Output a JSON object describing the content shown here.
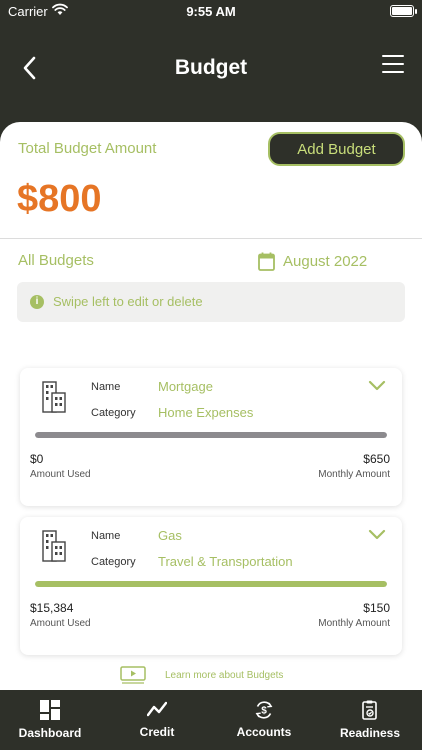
{
  "status_bar": {
    "carrier": "Carrier",
    "time": "9:55 AM"
  },
  "header": {
    "title": "Budget"
  },
  "summary": {
    "total_label": "Total Budget Amount",
    "total_amount": "$800",
    "add_button": "Add Budget"
  },
  "filter": {
    "all_label": "All Budgets",
    "month": "August 2022"
  },
  "hint": {
    "text": "Swipe left to edit or delete",
    "icon": "info-icon"
  },
  "budgets": [
    {
      "name_key": "Name",
      "name": "Mortgage",
      "category_key": "Category",
      "category": "Home Expenses",
      "used_value": "$0",
      "used_label": "Amount Used",
      "monthly_value": "$650",
      "monthly_label": "Monthly Amount",
      "progress": 1.0,
      "bar_color": "#8c8a8e"
    },
    {
      "name_key": "Name",
      "name": "Gas",
      "category_key": "Category",
      "category": "Travel & Transportation",
      "used_value": "$15,384",
      "used_label": "Amount Used",
      "monthly_value": "$150",
      "monthly_label": "Monthly Amount",
      "progress": 1.0,
      "bar_color": "#a6bf63"
    }
  ],
  "learn_more": {
    "text": "Learn more about Budgets",
    "icon": "video-play-icon"
  },
  "tabs": [
    {
      "label": "Dashboard",
      "icon": "dashboard-grid-icon"
    },
    {
      "label": "Credit",
      "icon": "trend-line-icon"
    },
    {
      "label": "Accounts",
      "icon": "dollar-cycle-icon"
    },
    {
      "label": "Readiness",
      "icon": "checklist-icon"
    }
  ],
  "colors": {
    "dark": "#2e3029",
    "accent_green": "#a6bf63",
    "amount_orange": "#e67525"
  }
}
